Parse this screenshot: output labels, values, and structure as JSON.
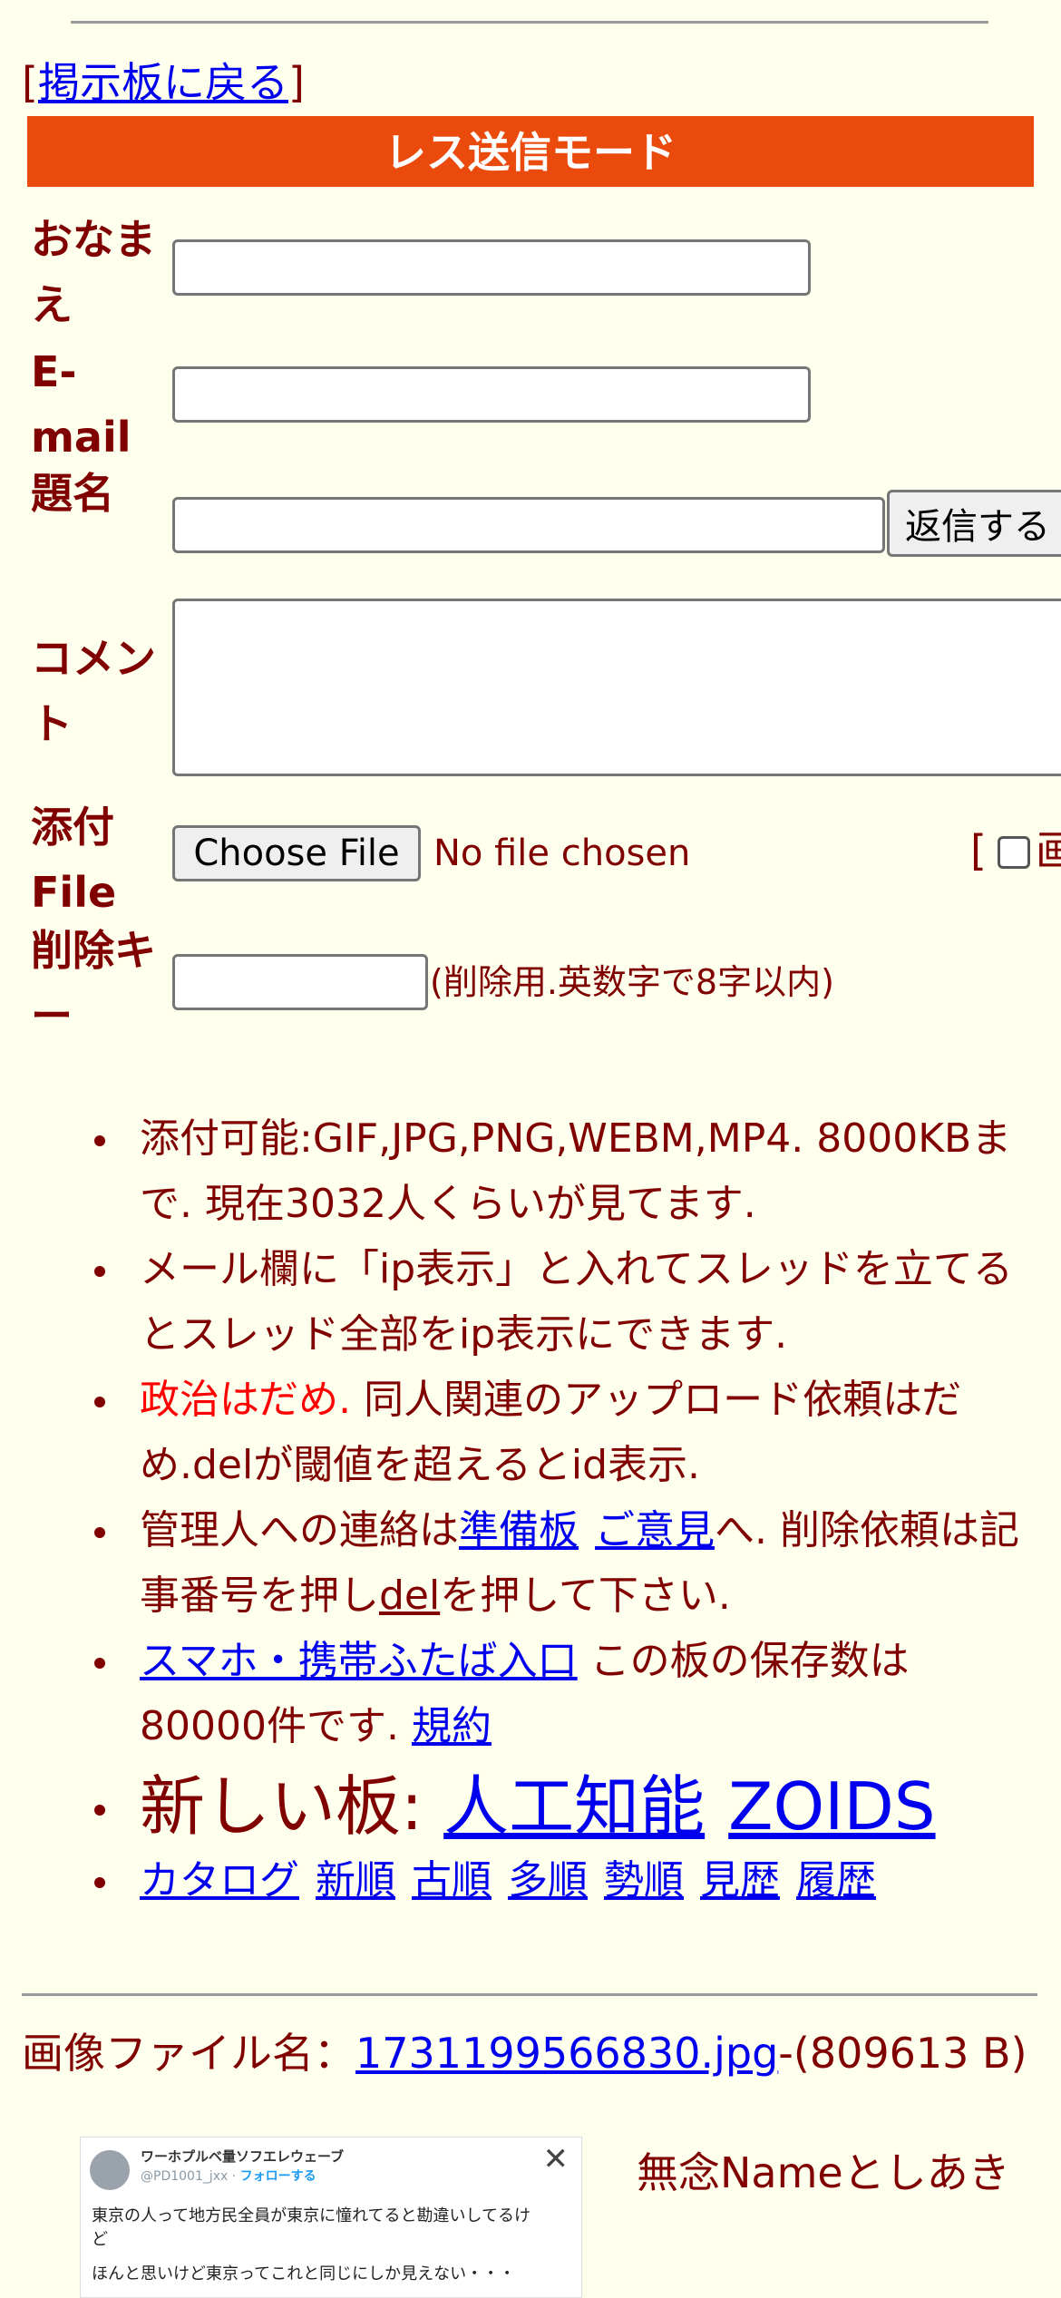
{
  "nav": {
    "back_open": "[",
    "back_label": "掲示板に戻る",
    "back_close": "]"
  },
  "form": {
    "mode_title": "レス送信モード",
    "name_label": "おなまえ",
    "email_label": "E-mail",
    "subject_label": "題名",
    "submit_label": "返信する",
    "comment_label": "コメント",
    "file_label": "添付File",
    "file_button": "Choose File",
    "file_status": "No file chosen",
    "image_opt_bracket": "[",
    "image_opt_label": "画",
    "delkey_label": "削除キー",
    "delkey_hint": "(削除用.英数字で8字以内)"
  },
  "rules": {
    "r1": "添付可能:GIF,JPG,PNG,WEBM,MP4. 8000KBまで. 現在3032人くらいが見てます.",
    "r2": "メール欄に「ip表示」と入れてスレッドを立てるとスレッド全部をip表示にできます.",
    "r3_red": "政治はだめ.",
    "r3_rest": " 同人関連のアップロード依頼はだめ.delが閾値を超えるとid表示.",
    "r4_a": "管理人への連絡は",
    "r4_link1": "準備板",
    "r4_link2": "ご意見",
    "r4_b": "へ. 削除依頼は記事番号を押し",
    "r4_del": "del",
    "r4_c": "を押して下さい.",
    "r5_link": "スマホ・携帯ふたば入口",
    "r5_text": " この板の保存数は80000件です. ",
    "r5_link2": "規約",
    "new_boards_label": "新しい板: ",
    "new_board_1": "人工知能",
    "new_board_2": "ZOIDS",
    "sort_links": [
      "カタログ",
      "新順",
      "古順",
      "多順",
      "勢順",
      "見歴",
      "履歴"
    ]
  },
  "post": {
    "file_prefix": "画像ファイル名：",
    "file_name": "1731199566830.jpg",
    "file_size": "-(809613 B)",
    "poster_name": "無念Nameとしあき"
  },
  "thumbnail": {
    "display_name": "ワーホプルベ量ソフエレウェーブ",
    "handle": "@PD1001_jxx · ",
    "follow": "フォローする",
    "close_glyph": "✕",
    "line1": "東京の人って地方民全員が東京に憧れてると勘違いしてるけ",
    "line2": "ど",
    "line3": "ほんと思いけど東京ってこれと同じにしか見えない・・・"
  },
  "colors": {
    "page_bg": "#ffffee",
    "text": "#800000",
    "mode_bar": "#ea4a0c",
    "link": "#0000ee",
    "alert": "#ff0000"
  }
}
